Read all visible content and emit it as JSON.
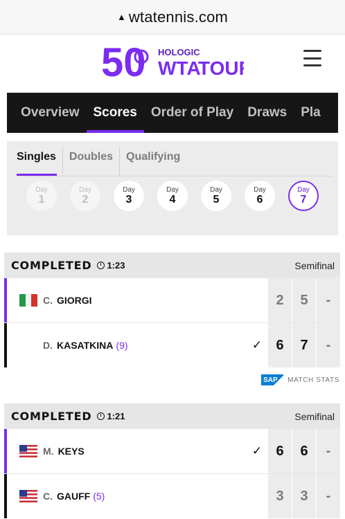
{
  "browser": {
    "url": "wtatennis.com",
    "lock_icon": "lock-icon"
  },
  "header": {
    "logo_sponsor": "HOLOGIC",
    "logo_brand": "WTA",
    "logo_tour": "TOUR",
    "logo_number": "50",
    "menu_icon": "hamburger-icon"
  },
  "nav": {
    "tabs": [
      "Overview",
      "Scores",
      "Order of Play",
      "Draws",
      "Pla"
    ],
    "active": "Scores"
  },
  "subtabs": {
    "items": [
      "Singles",
      "Doubles",
      "Qualifying"
    ],
    "active": "Singles"
  },
  "days": [
    {
      "label": "Day",
      "num": "1",
      "state": "disabled"
    },
    {
      "label": "Day",
      "num": "2",
      "state": "disabled"
    },
    {
      "label": "Day",
      "num": "3",
      "state": "normal"
    },
    {
      "label": "Day",
      "num": "4",
      "state": "normal"
    },
    {
      "label": "Day",
      "num": "5",
      "state": "normal"
    },
    {
      "label": "Day",
      "num": "6",
      "state": "normal"
    },
    {
      "label": "Day",
      "num": "7",
      "state": "selected"
    }
  ],
  "matches": [
    {
      "status": "COMPLETED",
      "duration": "1:23",
      "round": "Semifinal",
      "players": [
        {
          "initial": "C.",
          "name": "GIORGI",
          "seed": "",
          "flag": "italy",
          "winner": false,
          "sets": [
            "2",
            "5",
            "-"
          ]
        },
        {
          "initial": "D.",
          "name": "KASATKINA",
          "seed": "(9)",
          "flag": "",
          "winner": true,
          "sets": [
            "6",
            "7",
            "-"
          ]
        }
      ],
      "stats": {
        "brand": "SAP",
        "label": "MATCH STATS"
      }
    },
    {
      "status": "COMPLETED",
      "duration": "1:21",
      "round": "Semifinal",
      "players": [
        {
          "initial": "M.",
          "name": "KEYS",
          "seed": "",
          "flag": "usa",
          "winner": true,
          "sets": [
            "6",
            "6",
            "-"
          ]
        },
        {
          "initial": "C.",
          "name": "GAUFF",
          "seed": "(5)",
          "flag": "usa",
          "winner": false,
          "sets": [
            "3",
            "3",
            "-"
          ]
        }
      ]
    }
  ],
  "colors": {
    "accent": "#7b2cf0",
    "nav_bg": "#161616",
    "panel_bg": "#ececec"
  }
}
